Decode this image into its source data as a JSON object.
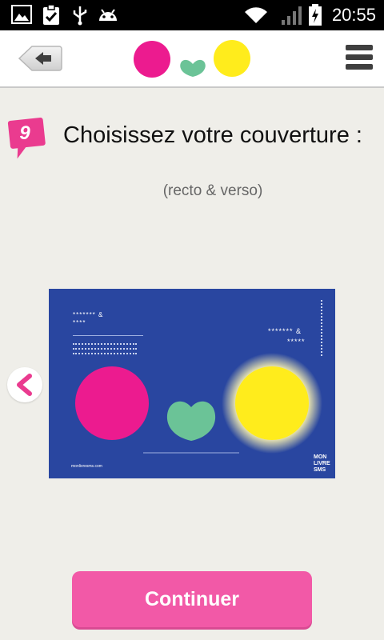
{
  "status_bar": {
    "time": "20:55",
    "icons": [
      "picture-icon",
      "clipboard-check-icon",
      "usb-icon",
      "android-icon",
      "wifi-icon",
      "signal-icon",
      "battery-charging-icon"
    ]
  },
  "header": {
    "back_icon": "back-arrow-icon",
    "menu_icon": "hamburger-menu-icon",
    "logo_colors": {
      "pink": "#ec1b8f",
      "green": "#6bc397",
      "yellow": "#ffec1c"
    }
  },
  "step": {
    "number": "9",
    "title": "Choisissez votre couverture :",
    "subtitle": "(recto & verso)"
  },
  "cover": {
    "background": "#2946a0",
    "left_stars": "******* &",
    "left_stars2": "****",
    "right_stars": "******* &",
    "right_stars2": "*****",
    "footer_url": "monlivresms.com",
    "brand_line1": "MON",
    "brand_line2": "LIVRE",
    "brand_line3": "SMS",
    "prev_icon": "chevron-left-icon"
  },
  "actions": {
    "continue_label": "Continuer"
  },
  "colors": {
    "accent": "#f259a7",
    "badge": "#ea3b8f"
  }
}
